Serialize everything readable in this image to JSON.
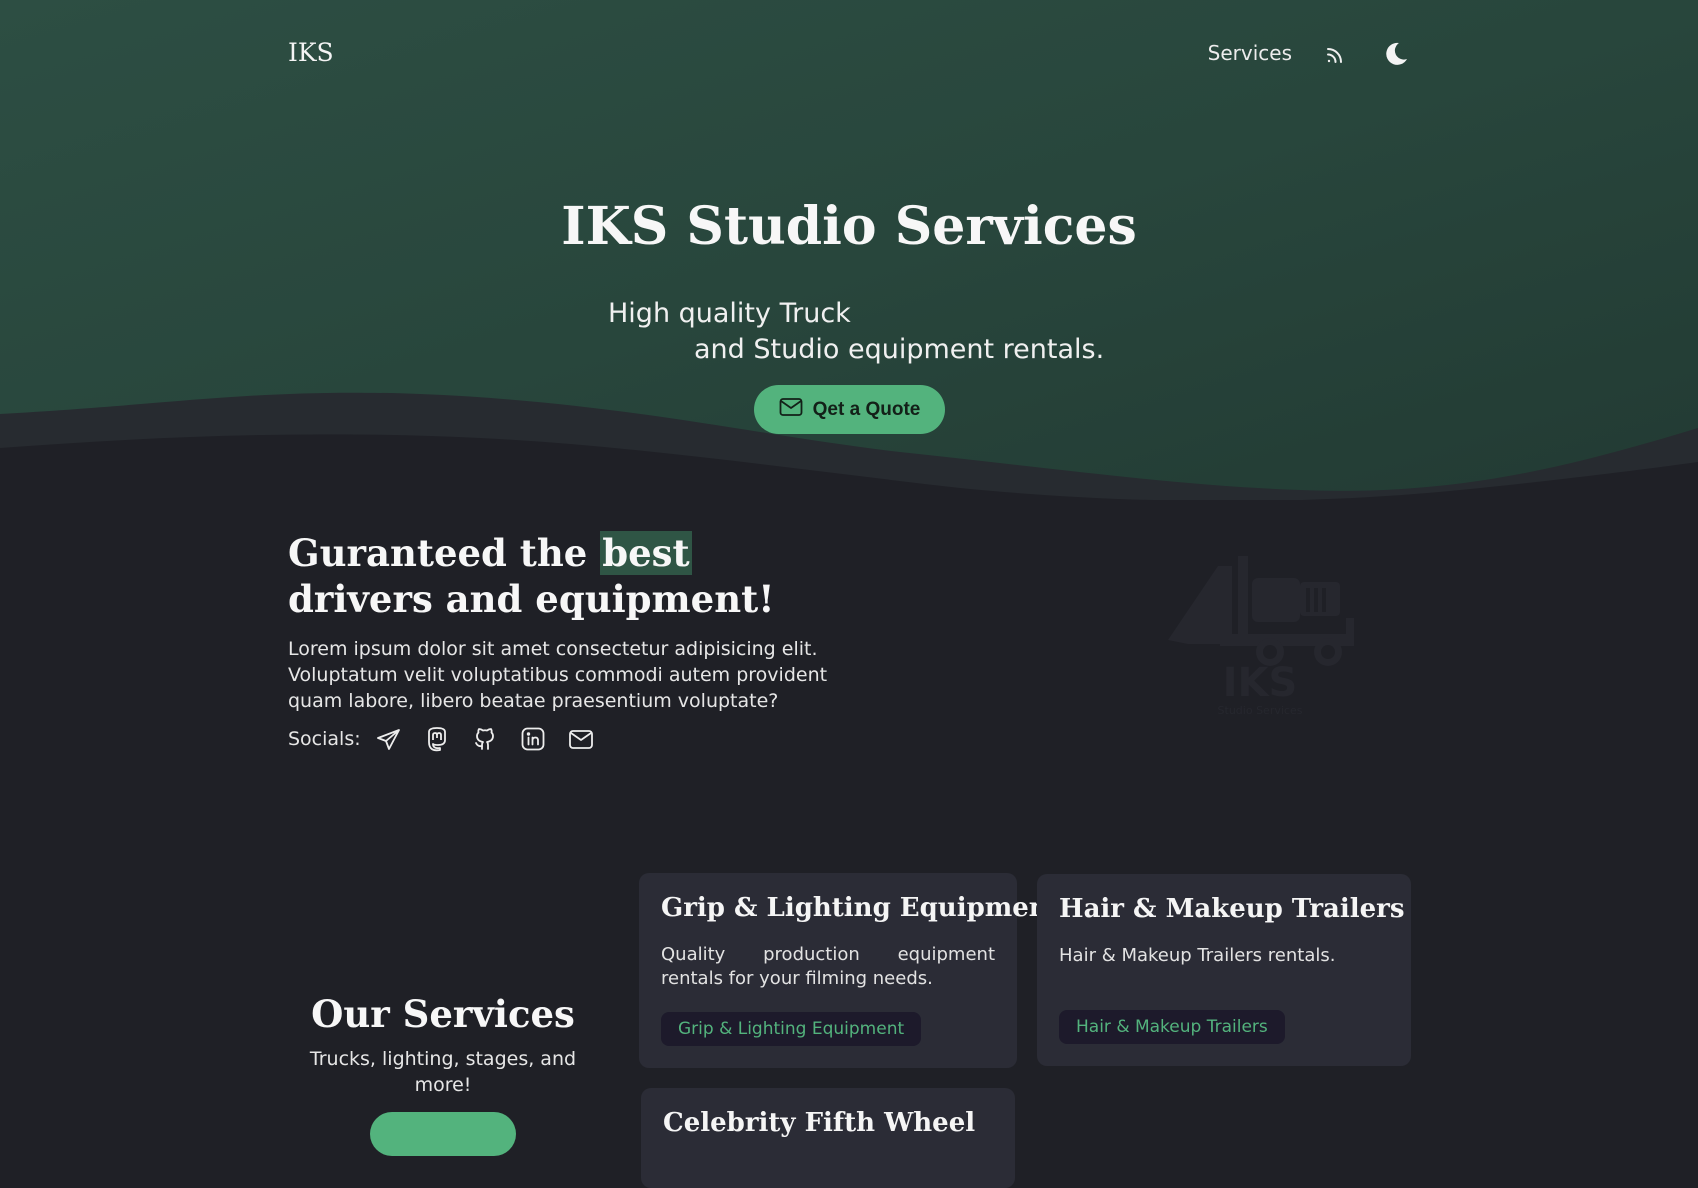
{
  "nav": {
    "brand": "IKS",
    "services_link": "Services",
    "rss_icon": "rss-icon",
    "theme_icon": "moon-icon"
  },
  "hero": {
    "title": "IKS Studio Services",
    "tagline_line1": "High quality Truck",
    "tagline_line2": "and Studio equipment rentals.",
    "cta_label": "Qet a Quote",
    "cta_icon": "mail-icon"
  },
  "about": {
    "title_before": "Guranteed the ",
    "title_highlight": "best",
    "title_after": " drivers and equipment!",
    "text": "Lorem ipsum dolor sit amet consectetur adipisicing elit. Voluptatum velit voluptatibus commodi autem provident quam labore, libero beatae praesentium voluptate?",
    "socials_label": "Socials:",
    "socials": [
      "telegram-icon",
      "mastodon-icon",
      "github-icon",
      "linkedin-icon",
      "mail-icon"
    ],
    "logo_text": "IKS",
    "logo_subtext": "Studio Services"
  },
  "services": {
    "title": "Our Services",
    "subtitle": "Trucks, lighting, stages, and more!",
    "cards": [
      {
        "title": "Grip & Lighting Equipment",
        "description": "Quality production equipment rentals for your filming needs.",
        "tag": "Grip & Lighting Equipment"
      },
      {
        "title": "Hair & Makeup Trailers",
        "description": "Hair & Makeup Trailers rentals.",
        "tag": "Hair & Makeup Trailers"
      },
      {
        "title": "Celebrity Fifth Wheel"
      }
    ]
  },
  "colors": {
    "background": "#1f2026",
    "hero": "#2b4a3f",
    "accent": "#53b37d",
    "card": "#2b2c36",
    "tag_bg": "#1d1a2b"
  }
}
